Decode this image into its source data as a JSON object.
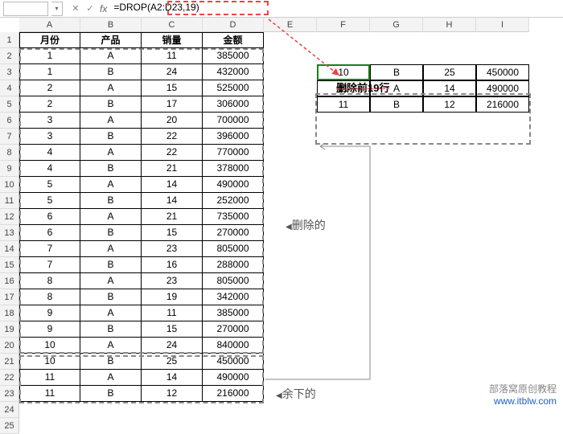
{
  "formula_bar": {
    "cell_ref": "",
    "formula": "=DROP(A2:D23,19)",
    "fx": "fx"
  },
  "col_labels": [
    "A",
    "B",
    "C",
    "D",
    "E",
    "F",
    "G",
    "H",
    "I"
  ],
  "row_labels": [
    "1",
    "2",
    "3",
    "4",
    "5",
    "6",
    "7",
    "8",
    "9",
    "10",
    "11",
    "12",
    "13",
    "14",
    "15",
    "16",
    "17",
    "18",
    "19",
    "20",
    "21",
    "22",
    "23",
    "24",
    "25"
  ],
  "headers": {
    "a": "月份",
    "b": "产品",
    "c": "销量",
    "d": "金额"
  },
  "rows": [
    {
      "a": "1",
      "b": "A",
      "c": "11",
      "d": "385000"
    },
    {
      "a": "1",
      "b": "B",
      "c": "24",
      "d": "432000"
    },
    {
      "a": "2",
      "b": "A",
      "c": "15",
      "d": "525000"
    },
    {
      "a": "2",
      "b": "B",
      "c": "17",
      "d": "306000"
    },
    {
      "a": "3",
      "b": "A",
      "c": "20",
      "d": "700000"
    },
    {
      "a": "3",
      "b": "B",
      "c": "22",
      "d": "396000"
    },
    {
      "a": "4",
      "b": "A",
      "c": "22",
      "d": "770000"
    },
    {
      "a": "4",
      "b": "B",
      "c": "21",
      "d": "378000"
    },
    {
      "a": "5",
      "b": "A",
      "c": "14",
      "d": "490000"
    },
    {
      "a": "5",
      "b": "B",
      "c": "14",
      "d": "252000"
    },
    {
      "a": "6",
      "b": "A",
      "c": "21",
      "d": "735000"
    },
    {
      "a": "6",
      "b": "B",
      "c": "15",
      "d": "270000"
    },
    {
      "a": "7",
      "b": "A",
      "c": "23",
      "d": "805000"
    },
    {
      "a": "7",
      "b": "B",
      "c": "16",
      "d": "288000"
    },
    {
      "a": "8",
      "b": "A",
      "c": "23",
      "d": "805000"
    },
    {
      "a": "8",
      "b": "B",
      "c": "19",
      "d": "342000"
    },
    {
      "a": "9",
      "b": "A",
      "c": "11",
      "d": "385000"
    },
    {
      "a": "9",
      "b": "B",
      "c": "15",
      "d": "270000"
    },
    {
      "a": "10",
      "b": "A",
      "c": "24",
      "d": "840000"
    },
    {
      "a": "10",
      "b": "B",
      "c": "25",
      "d": "450000"
    },
    {
      "a": "11",
      "b": "A",
      "c": "14",
      "d": "490000"
    },
    {
      "a": "11",
      "b": "B",
      "c": "12",
      "d": "216000"
    }
  ],
  "result_label": "删除前19行",
  "result_rows": [
    {
      "a": "10",
      "b": "B",
      "c": "25",
      "d": "450000"
    },
    {
      "a": "11",
      "b": "A",
      "c": "14",
      "d": "490000"
    },
    {
      "a": "11",
      "b": "B",
      "c": "12",
      "d": "216000"
    }
  ],
  "ann_deleted": "删除的",
  "ann_remain": "余下的",
  "watermark": {
    "l1": "部落窝原创教程",
    "l2": "www.itblw.com"
  }
}
